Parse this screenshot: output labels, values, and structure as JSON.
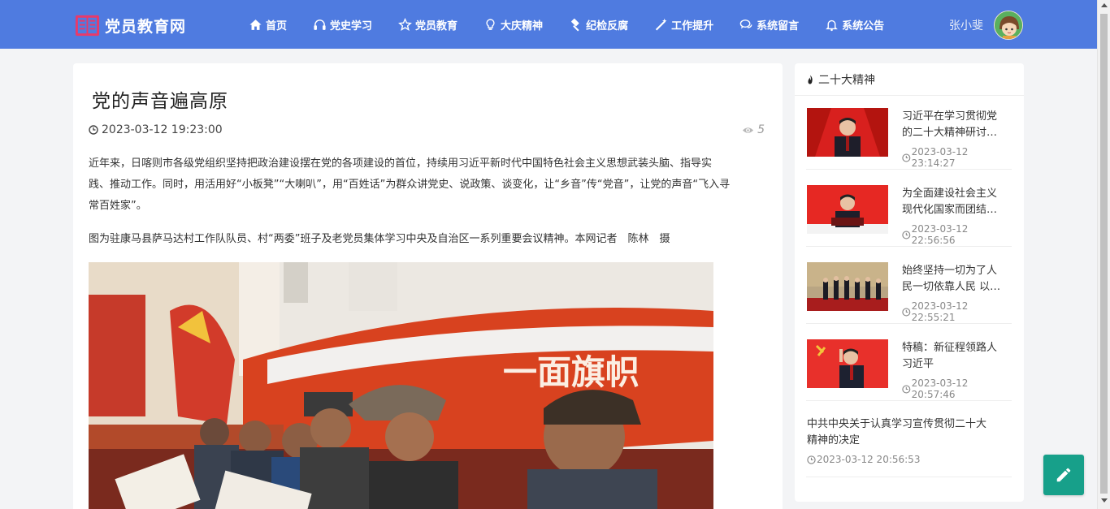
{
  "site": {
    "name": "党员教育网"
  },
  "nav": [
    {
      "label": "首页",
      "icon": "home-icon"
    },
    {
      "label": "党史学习",
      "icon": "headphones-icon"
    },
    {
      "label": "党员教育",
      "icon": "star-icon"
    },
    {
      "label": "大庆精神",
      "icon": "lightbulb-icon"
    },
    {
      "label": "纪检反腐",
      "icon": "gavel-icon"
    },
    {
      "label": "工作提升",
      "icon": "magic-wand-icon"
    },
    {
      "label": "系统留言",
      "icon": "comments-icon"
    },
    {
      "label": "系统公告",
      "icon": "bell-icon"
    }
  ],
  "user": {
    "name": "张小斐"
  },
  "article": {
    "title": "党的声音遍高原",
    "date": "2023-03-12 19:23:00",
    "views": "5",
    "lines": [
      "近年来，日喀则市各级党组织坚持把政治建设摆在党的各项建设的首位，持续用习近平新时代中国特色社会主义思想武装头脑、指导实",
      "践、推动工作。同时，用活用好“小板凳”“大喇叭”，用“百姓话”为群众讲党史、说政策、谈变化，让“乡音”传“党音”，让党的声音“飞入寻",
      "常百姓家”。"
    ],
    "caption": "图为驻康马县萨马达村工作队队员、村“两委”班子及老党员集体学习中央及自治区一系列重要会议精神。本网记者　陈林　摄",
    "photo_text": "一面旗帜"
  },
  "sidebar": {
    "title": "二十大精神",
    "items": [
      {
        "lines": [
          "习近平在学习贯彻党",
          "的二十大精神研讨…"
        ],
        "date": "2023-03-12 23:14:27",
        "has_thumb": true
      },
      {
        "lines": [
          "为全面建设社会主义",
          "现代化国家而团结…"
        ],
        "date": "2023-03-12 22:56:56",
        "has_thumb": true
      },
      {
        "lines": [
          "始终坚持一切为了人",
          "民一切依靠人民 以…"
        ],
        "date": "2023-03-12 22:55:21",
        "has_thumb": true
      },
      {
        "lines": [
          "特稿：新征程领路人",
          "习近平"
        ],
        "date": "2023-03-12 20:57:46",
        "has_thumb": true
      },
      {
        "lines": [
          "中共中央关于认真学习宣传贯彻二十大",
          "精神的决定"
        ],
        "date": "2023-03-12 20:56:53",
        "has_thumb": false
      }
    ]
  },
  "colors": {
    "nav_bg": "#4f7be0",
    "fab_bg": "#17a08a",
    "accent_red": "#c8161d"
  }
}
